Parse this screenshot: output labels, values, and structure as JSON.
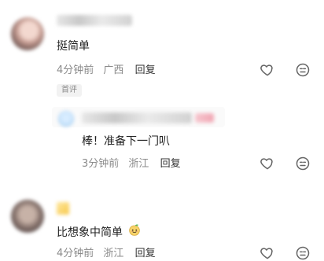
{
  "comments": [
    {
      "text": "挺简单",
      "time": "4分钟前",
      "region": "广西",
      "reply_label": "回复",
      "badge": "首评",
      "icons": [
        "heart-icon",
        "dislike-face-icon"
      ]
    },
    {
      "text": "棒！准备下一门叭",
      "time": "3分钟前",
      "region": "浙江",
      "reply_label": "回复",
      "icons": [
        "heart-icon",
        "dislike-face-icon"
      ]
    },
    {
      "text": "比想象中简单",
      "time": "4分钟前",
      "region": "浙江",
      "reply_label": "回复",
      "emoji": "smiling-fruit-emoji",
      "icons": [
        "heart-icon",
        "dislike-face-icon"
      ]
    }
  ],
  "colors": {
    "text": "#222222",
    "meta": "#8a8a8a",
    "icon": "#666666"
  }
}
